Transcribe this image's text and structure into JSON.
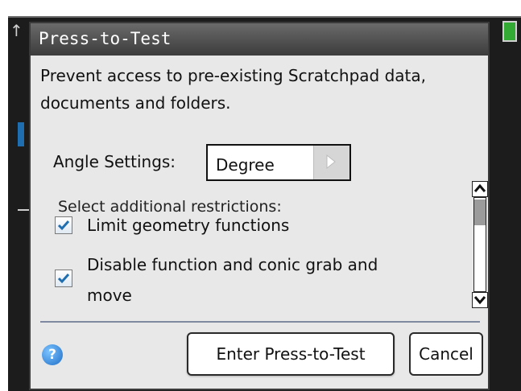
{
  "dialog": {
    "title": "Press-to-Test",
    "description": "Prevent access to pre-existing Scratchpad data, documents and folders.",
    "angle": {
      "label": "Angle Settings:",
      "value": "Degree"
    },
    "restrictions_label": "Select additional restrictions:",
    "restrictions": [
      {
        "label": "Limit geometry functions",
        "checked": true
      },
      {
        "label_line1": "Disable function and conic grab and",
        "label_line2": "move",
        "checked": true
      }
    ],
    "buttons": {
      "enter": "Enter Press-to-Test",
      "cancel": "Cancel"
    },
    "help_icon": "?"
  },
  "icons": {
    "help": "help-icon",
    "checkbox": "checkmark-icon",
    "dropdown_arrow": "triangle-right-icon",
    "scroll_up": "chevron-up-icon",
    "scroll_down": "chevron-down-icon"
  },
  "colors": {
    "titlebar": "#3c3c3c",
    "dialog_bg": "#e8e8e8",
    "check_blue": "#1f6fb0",
    "help_blue": "#1f6fc8"
  }
}
